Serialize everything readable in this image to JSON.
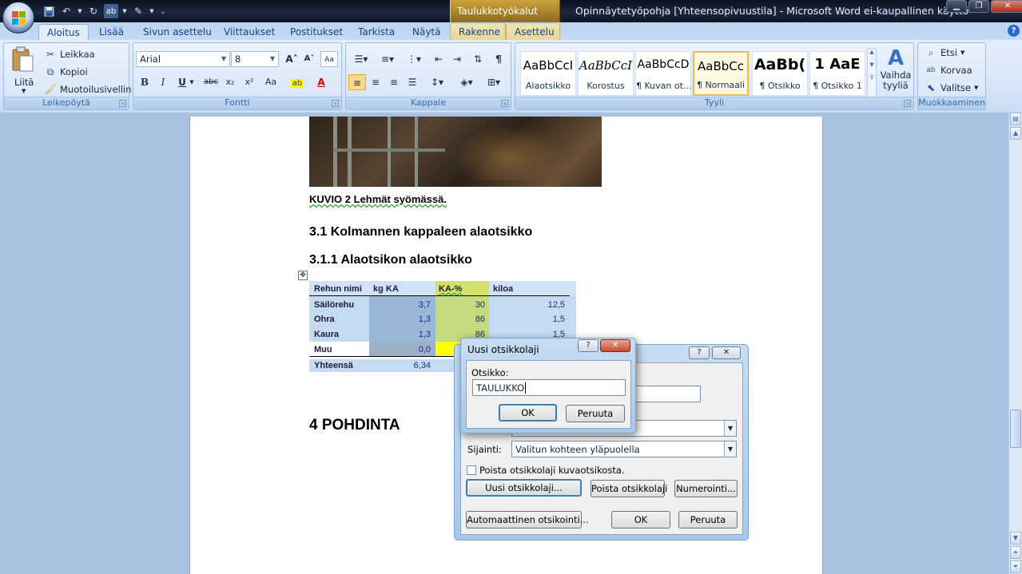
{
  "window": {
    "title": "Opinnäytetyöpohja [Yhteensopivuustila] - Microsoft Word ei-kaupallinen käyttö",
    "context_tab": "Taulukkotyökalut",
    "controls": {
      "minimize": "▁",
      "maximize": "❐",
      "close": "✕"
    }
  },
  "qat": {
    "icons": [
      "save-icon",
      "undo-icon",
      "redo-icon",
      "spelling-icon",
      "format-painter-icon",
      "customize-icon"
    ]
  },
  "tabs": [
    "Aloitus",
    "Lisää",
    "Sivun asettelu",
    "Viittaukset",
    "Postitukset",
    "Tarkista",
    "Näytä",
    "Rakenne",
    "Asettelu"
  ],
  "active_tab": "Aloitus",
  "ribbon": {
    "clipboard": {
      "label": "Leikepöytä",
      "paste": "Liitä",
      "cut": "Leikkaa",
      "copy": "Kopioi",
      "format_painter": "Muotoilusivellin"
    },
    "font": {
      "label": "Fontti",
      "family": "Arial",
      "size": "8",
      "bold": "B",
      "italic": "I",
      "underline": "U",
      "strike": "abc",
      "sub": "x₂",
      "sup": "x²",
      "case": "Aa",
      "grow": "A˄",
      "shrink": "A˅"
    },
    "paragraph": {
      "label": "Kappale"
    },
    "styles": {
      "label": "Tyyli",
      "items": [
        {
          "sample": "AaBbCcI",
          "name": "Alaotsikko"
        },
        {
          "sample": "AaBbCcI",
          "name": "Korostus"
        },
        {
          "sample": "AaBbCcD",
          "name": "¶ Kuvan ot..."
        },
        {
          "sample": "AaBbCc",
          "name": "¶ Normaali"
        },
        {
          "sample": "AaBb(",
          "name": "¶ Otsikko"
        },
        {
          "sample": "1  AaE",
          "name": "¶ Otsikko 1"
        }
      ],
      "change": "Vaihda tyyliä"
    },
    "editing": {
      "label": "Muokkaaminen",
      "find": "Etsi",
      "replace": "Korvaa",
      "select": "Valitse"
    }
  },
  "document": {
    "caption": "KUVIO 2 Lehmät syömässä.",
    "h31": "3.1    Kolmannen kappaleen alaotsikko",
    "h311": "3.1.1   Alaotsikon alaotsikko",
    "h4": "4   POHDINTA",
    "table": {
      "headers": [
        "Rehun nimi",
        "kg KA",
        "KA-%",
        "kiloa"
      ],
      "rows": [
        [
          "Säilörehu",
          "3,7",
          "30",
          "12,5"
        ],
        [
          "Ohra",
          "1,3",
          "86",
          "1,5"
        ],
        [
          "Kaura",
          "1,3",
          "86",
          "1,5"
        ],
        [
          "Muu",
          "0,0",
          "",
          ""
        ],
        [
          "Yhteensä",
          "6,34",
          "",
          ""
        ]
      ]
    }
  },
  "caption_dialog": {
    "help": "?",
    "close": "✕",
    "location_label": "Sijainti:",
    "location_value": "Valitun kohteen yläpuolella",
    "exclude_label": "Poista otsikkolaji kuvaotsikosta.",
    "new_label": "Uusi otsikkolaji...",
    "delete_label": "Poista otsikkolaji",
    "numbering": "Numerointi...",
    "autocaption": "Automaattinen otsikointi...",
    "ok": "OK",
    "cancel": "Peruuta"
  },
  "new_label_dialog": {
    "title": "Uusi otsikkolaji",
    "help": "?",
    "close": "✕",
    "field_label": "Otsikko:",
    "field_value": "TAULUKKO",
    "ok": "OK",
    "cancel": "Peruuta"
  }
}
